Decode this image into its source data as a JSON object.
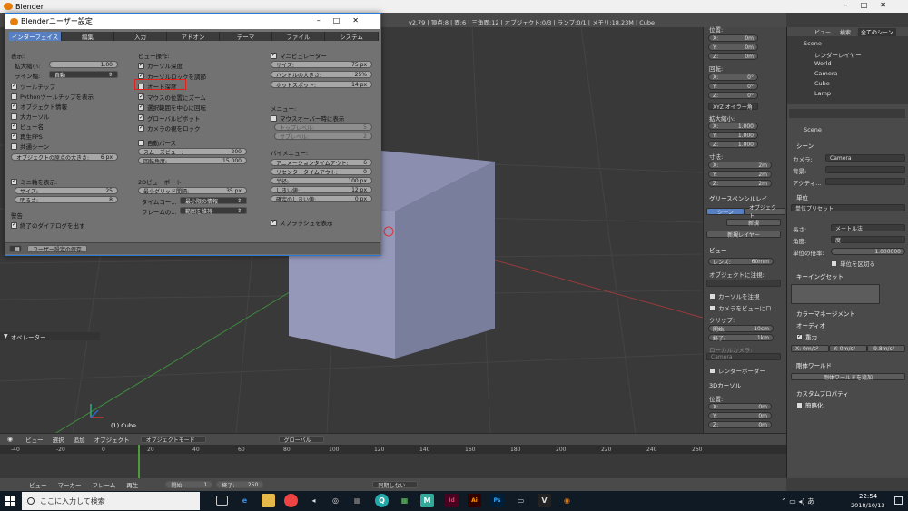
{
  "app": {
    "title": "Blender",
    "info": "v2.79 | 頂点:8 | 面:6 | 三角面:12 | オブジェクト:0/3 | ランプ:0/1 | メモリ:18.23M | Cube"
  },
  "prefs": {
    "title": "Blenderユーザー設定",
    "tabs": [
      "インターフェイス",
      "編集",
      "入力",
      "アドオン",
      "テーマ",
      "ファイル",
      "システム"
    ],
    "display_label": "表示:",
    "scale_label": "拡大縮小:",
    "scale_value": "1.00",
    "linewidth_label": "ライン幅:",
    "linewidth_value": "自動",
    "left_checks": [
      {
        "label": "ツールチップ",
        "on": true
      },
      {
        "label": "Pythonツールチップを表示",
        "on": false
      },
      {
        "label": "オブジェクト情報",
        "on": true
      },
      {
        "label": "大カーソル",
        "on": false
      },
      {
        "label": "ビュー名",
        "on": true
      },
      {
        "label": "再生FPS",
        "on": true
      },
      {
        "label": "共通シーン",
        "on": false
      }
    ],
    "origin_label": "オブジェクトの原点の大きさ:",
    "origin_value": "6 px",
    "minimap_label": "ミニ軸を表示:",
    "size_label": "サイズ:",
    "size_value": "25",
    "bright_label": "明るさ:",
    "bright_value": "8",
    "warning_label": "警告",
    "quit_label": "終了のダイアログを出す",
    "save_button": "ユーザー設定の保存",
    "view_ops_label": "ビュー操作:",
    "mid_checks": [
      {
        "label": "カーソル深度",
        "on": true
      },
      {
        "label": "カーソルロックを調節",
        "on": true
      },
      {
        "label": "オート深度",
        "on": false
      },
      {
        "label": "マウスの位置にズーム",
        "on": true
      },
      {
        "label": "選択範囲を中心に回転",
        "on": true
      },
      {
        "label": "グローバルピボット",
        "on": true
      },
      {
        "label": "カメラの視をロック",
        "on": true
      }
    ],
    "autopers_label": "自動パース",
    "smooth_label": "スムーズビュー:",
    "smooth_value": "200",
    "rotate_label": "回転角度:",
    "rotate_value": "15.000",
    "viewport2d_label": "2Dビューポート",
    "gridspacing_label": "最小グリッド間隔:",
    "gridspacing_value": "35 px",
    "timecode_label": "タイムコー...",
    "timecode_value": "最小限の情報",
    "frame_label": "フレームの...",
    "frame_value": "範囲を維持",
    "manip_label": "マニピュレーター",
    "msize_label": "サイズ:",
    "msize_value": "75 px",
    "handle_label": "ハンドルの大きさ:",
    "handle_value": "25%",
    "hotspot_label": "ホットスポット:",
    "hotspot_value": "14 px",
    "menu_label": "メニュー:",
    "mouseover_label": "マウスオーバー時に表示",
    "toplevel_label": "トップレベル:",
    "toplevel_value": "5",
    "sublevel_label": "サブレベル:",
    "sublevel_value": "2",
    "pie_label": "パイメニュー:",
    "anim_label": "アニメーションタイムアウト:",
    "anim_value": "6",
    "recenter_label": "リセンタータイムアウト:",
    "recenter_value": "0",
    "radius_label": "半径:",
    "radius_value": "100 px",
    "thresh_label": "しきい値:",
    "thresh_value": "12 px",
    "confirm_label": "確定のしきい値:",
    "confirm_value": "0 px",
    "splash_label": "スプラッシュを表示"
  },
  "npanel": {
    "location": "位置:",
    "loc": [
      "X:",
      "Y:",
      "Z:"
    ],
    "loc_vals": [
      "0m",
      "0m",
      "0m"
    ],
    "rotation": "回転:",
    "rot_vals": [
      "0°",
      "0°",
      "0°"
    ],
    "rot_mode": "XYZ オイラー角",
    "scale": "拡大縮小:",
    "scale_vals": [
      "1.000",
      "1.000",
      "1.000"
    ],
    "dims": "寸法:",
    "dim_vals": [
      "2m",
      "2m",
      "2m"
    ],
    "gpencil": "グリースペンシルレイ",
    "gp_scene": "シーン",
    "gp_object": "オブジェクト",
    "gp_new": "新規",
    "gp_newlayer": "新規レイヤー",
    "view": "ビュー",
    "lens": "レンズ:",
    "lens_val": "60mm",
    "lockobj": "オブジェクトに注視:",
    "lockcursor": "カーソルを注視",
    "lockcam": "カメラをビューにロ...",
    "clip": "クリップ:",
    "start": "開始:",
    "start_val": "10cm",
    "end": "終了:",
    "end_val": "1km",
    "localcam": "ローカルカメラ:",
    "camera": "Camera",
    "renderborder": "レンダーボーダー",
    "cursor3d": "3Dカーソル",
    "cursorloc": "位置:"
  },
  "outliner": {
    "tabs": [
      "ビュー",
      "検索",
      "全てのシーン"
    ],
    "items": [
      "Scene",
      "レンダーレイヤー",
      "World",
      "Camera",
      "Cube",
      "Lamp"
    ]
  },
  "props": {
    "scene": "Scene",
    "scene_panel": "シーン",
    "camera_label": "カメラ:",
    "camera_val": "Camera",
    "bg_label": "背景:",
    "active_label": "アクティ...",
    "units": "単位",
    "unit_preset": "単位プリセット",
    "length_label": "長さ:",
    "length_val": "メートル法",
    "angle_label": "角度:",
    "angle_val": "度",
    "unitscale_label": "単位の倍率:",
    "unitscale_val": "1.000000",
    "separate": "単位を区切る",
    "keying": "キーイングセット",
    "color_mgmt": "カラーマネージメント",
    "audio": "オーディオ",
    "gravity": "重力",
    "grav": [
      "X: 0m/s²",
      "Y: 0m/s²",
      "-9.8m/s²"
    ],
    "rigid": "剛体ワールド",
    "rigid_btn": "剛体ワールドを追加",
    "custom": "カスタムプロパティ",
    "simplify": "簡略化"
  },
  "viewport": {
    "object_label": "(1) Cube",
    "operator": "オペレーター"
  },
  "vheader": {
    "items": [
      "ビュー",
      "選択",
      "追加",
      "オブジェクト"
    ],
    "mode": "オブジェクトモード",
    "pivot": "グローバル"
  },
  "timeline": {
    "ticks": [
      "-40",
      "-20",
      "0",
      "20",
      "40",
      "60",
      "80",
      "100",
      "120",
      "140",
      "160",
      "180",
      "200",
      "220",
      "240",
      "260"
    ],
    "start_label": "開始:",
    "start_val": "1",
    "end_label": "終了:",
    "end_val": "250",
    "sync": "同期しない"
  },
  "tlbar": {
    "items": [
      "ビュー",
      "マーカー",
      "フレーム",
      "再生"
    ]
  },
  "taskbar": {
    "search": "ここに入力して検索",
    "time": "22:54",
    "date": "2018/10/13"
  }
}
